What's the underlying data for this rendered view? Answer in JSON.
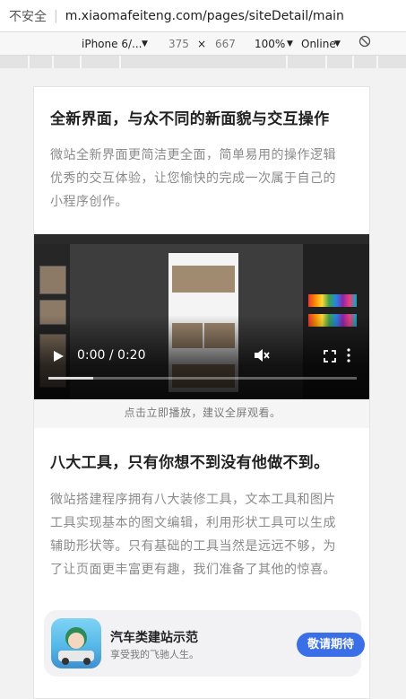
{
  "browser": {
    "security_label": "不安全",
    "url": "m.xiaomafeiteng.com/pages/siteDetail/main"
  },
  "device_toolbar": {
    "device": "iPhone 6/...",
    "width": "375",
    "times": "×",
    "height": "667",
    "zoom": "100%",
    "network": "Online"
  },
  "section1": {
    "heading": "全新界面，与众不同的新面貌与交互操作",
    "paragraph_lines": [
      "微站全新界面更简洁更全面，简单易用的操作逻辑",
      "优秀的交互体验，让您愉快的完成一次属于自己的",
      "小程序创作。"
    ]
  },
  "video": {
    "time_display": "0:00 / 0:20",
    "progress": 0.0,
    "icons": [
      "play-icon",
      "mute-icon",
      "fullscreen-icon",
      "more-vertical-icon"
    ]
  },
  "video_caption": "点击立即播放，建议全屏观看。",
  "section2": {
    "heading": "八大工具，只有你想不到没有他做不到。",
    "paragraph_lines": [
      "微站搭建程序拥有八大装修工具，文本工具和图片",
      "工具实现基本的图文编辑，利用形状工具可以生成",
      "辅助形状等。只有基础的工具当然是远远不够，为",
      "了让页面更丰富更有趣，我们准备了其他的惊喜。"
    ]
  },
  "promo": {
    "title": "汽车类建站示范",
    "subtitle": "享受我的飞驰人生。",
    "button": "敬请期待"
  },
  "colors": {
    "accent_button": "#3a6fe8",
    "heading": "#222222",
    "body_text": "#8a8a8a"
  }
}
